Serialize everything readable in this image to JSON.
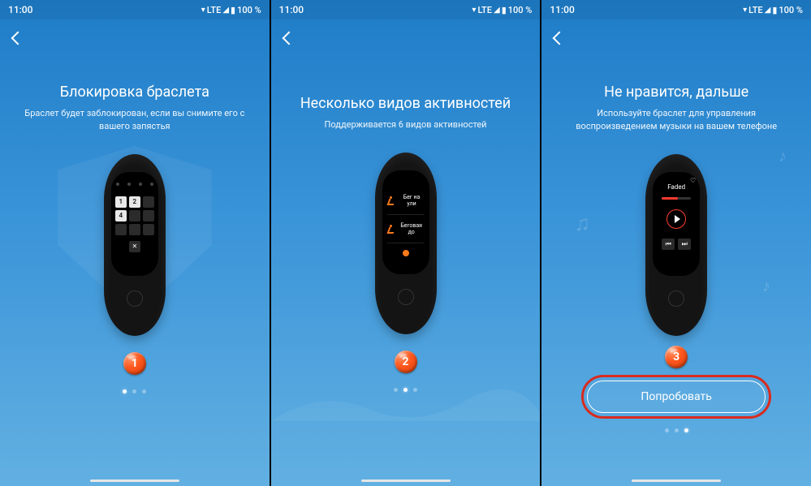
{
  "status": {
    "time": "11:00",
    "network": "LTE",
    "battery": "100 %"
  },
  "icons": {
    "wifi": "▾",
    "signal": "◢",
    "batt": "▮"
  },
  "screens": [
    {
      "title": "Блокировка браслета",
      "subtitle": "Браслет будет заблокирован, если вы снимите его с вашего запястья",
      "step": "1",
      "dots_active": 0,
      "device": {
        "kind": "lock",
        "keys": {
          "k1": "1",
          "k2": "2",
          "k4": "4",
          "x": "✕"
        }
      }
    },
    {
      "title": "Несколько видов активностей",
      "subtitle": "Поддерживается 6 видов активностей",
      "step": "2",
      "dots_active": 1,
      "device": {
        "kind": "activities",
        "items": [
          "Бег на ули",
          "Беговая до"
        ]
      }
    },
    {
      "title": "Не нравится, дальше",
      "subtitle": "Используйте браслет для управления воспроизведением музыки на вашем телефоне",
      "step": "3",
      "dots_active": 2,
      "cta": "Попробовать",
      "device": {
        "kind": "music",
        "track": "Faded",
        "prev": "⏮",
        "next": "⏭",
        "heart": "♡"
      }
    }
  ]
}
